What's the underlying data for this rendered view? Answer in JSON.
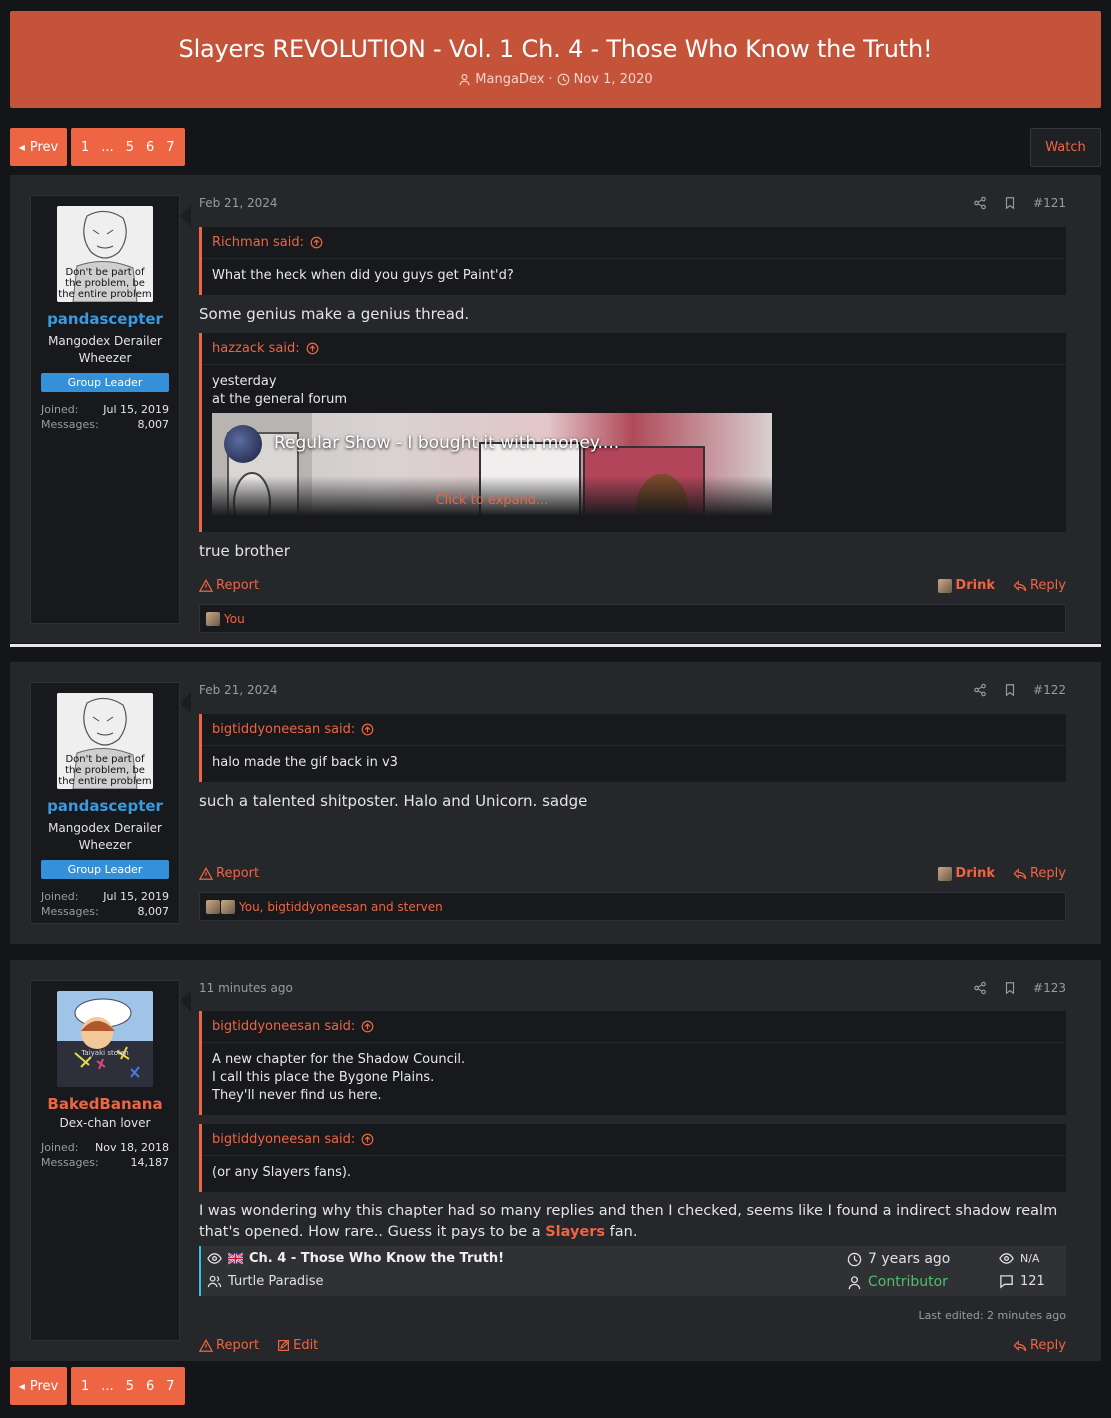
{
  "thread": {
    "title": "Slayers REVOLUTION - Vol. 1 Ch. 4 - Those Who Know the Truth!",
    "author": "MangaDex",
    "date": "Nov 1, 2020",
    "separator": "·"
  },
  "pagination": {
    "prev_label": "Prev",
    "pages": [
      "1",
      "...",
      "5",
      "6",
      "7"
    ]
  },
  "watch_label": "Watch",
  "posts": [
    {
      "user": {
        "name": "pandascepter",
        "name_color": "#3a9ae0",
        "title": "Mangodex Derailer Wheezer",
        "badge": "Group Leader",
        "avatar_caption": "Don't be part of the problem, be the entire problem",
        "joined_label": "Joined:",
        "joined": "Jul 15, 2019",
        "messages_label": "Messages:",
        "messages": "8,007"
      },
      "date": "Feb 21, 2024",
      "number": "#121",
      "quotes": [
        {
          "author": "Richman said:",
          "lines": [
            "What the heck when did you guys get Paint'd?"
          ]
        },
        {
          "author": "hazzack said:",
          "lines": [
            "yesterday",
            "at the general forum"
          ],
          "embed_title": "Regular Show - I bought it with money....",
          "expand": "Click to expand..."
        }
      ],
      "text_before": "Some genius make a genius thread.",
      "text_after": "true brother",
      "report": "Report",
      "drink": "Drink",
      "reply": "Reply",
      "reactions": "You"
    },
    {
      "user": {
        "name": "pandascepter",
        "title": "Mangodex Derailer Wheezer",
        "badge": "Group Leader",
        "avatar_caption": "Don't be part of the problem, be the entire problem",
        "joined_label": "Joined:",
        "joined": "Jul 15, 2019",
        "messages_label": "Messages:",
        "messages": "8,007"
      },
      "date": "Feb 21, 2024",
      "number": "#122",
      "quotes": [
        {
          "author": "bigtiddyoneesan said:",
          "lines": [
            "halo made the gif back in v3"
          ]
        }
      ],
      "text": "such a talented shitposter. Halo and Unicorn. sadge",
      "report": "Report",
      "drink": "Drink",
      "reply": "Reply",
      "reactions": "You, bigtiddyoneesan and sterven"
    },
    {
      "user": {
        "name": "BakedBanana",
        "name_color": "#ee6543",
        "title": "Dex-chan lover",
        "avatar_caption": "Taiyaki stolen",
        "joined_label": "Joined:",
        "joined": "Nov 18, 2018",
        "messages_label": "Messages:",
        "messages": "14,187"
      },
      "date": "11 minutes ago",
      "number": "#123",
      "quotes": [
        {
          "author": "bigtiddyoneesan said:",
          "lines": [
            "A new chapter for the Shadow Council.",
            "I call this place the Bygone Plains.",
            "They'll never find us here."
          ]
        },
        {
          "author": "bigtiddyoneesan said:",
          "lines": [
            "(or any Slayers fans)."
          ]
        }
      ],
      "text_1": "I was wondering why this chapter had so many replies and then I checked, seems like I found a indirect shadow realm that's opened. How rare.. Guess it pays to be a ",
      "text_highlight": "Slayers",
      "text_2": " fan.",
      "chapter_card": {
        "title": "Ch. 4 - Those Who Know the Truth!",
        "group": "Turtle Paradise",
        "time": "7 years ago",
        "uploader": "Contributor",
        "views": "N/A",
        "comments": "121"
      },
      "last_edited": "Last edited: 2 minutes ago",
      "report": "Report",
      "edit": "Edit",
      "reply": "Reply"
    }
  ]
}
